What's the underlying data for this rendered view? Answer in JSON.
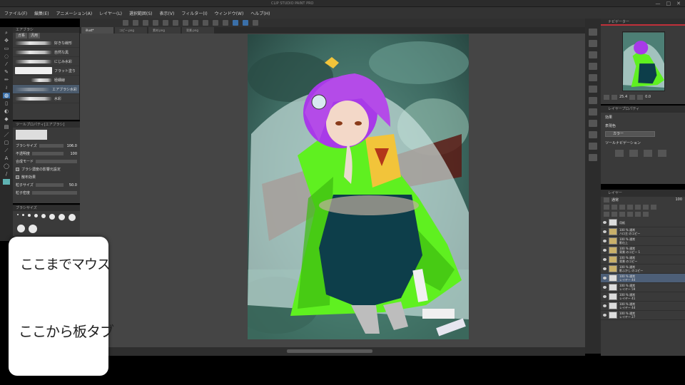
{
  "window": {
    "title": "CLIP STUDIO PAINT PRO",
    "controls": [
      "—",
      "□",
      "✕"
    ]
  },
  "menu": {
    "items": [
      "ファイル(F)",
      "編集(E)",
      "アニメーション(A)",
      "レイヤー(L)",
      "選択範囲(S)",
      "表示(V)",
      "フィルター(I)",
      "ウィンドウ(W)",
      "ヘルプ(H)"
    ]
  },
  "tabs": {
    "documents": [
      "illust*",
      "コピー.png",
      "素材.png",
      "背景.png"
    ]
  },
  "toolbar": {
    "tools": [
      "zoom",
      "move",
      "select",
      "lasso",
      "eyedropper",
      "pen",
      "pencil",
      "brush",
      "airbrush",
      "eraser",
      "fill",
      "gradient",
      "figure",
      "text",
      "balloon",
      "line"
    ]
  },
  "subtool": {
    "title": "エアブラシ",
    "tabs": [
      "ガ系",
      "汎用"
    ],
    "brushes": [
      {
        "name": "好きな線形"
      },
      {
        "name": "自然な黒"
      },
      {
        "name": "にじみ水彩"
      },
      {
        "name": "フラット塗り"
      },
      {
        "name": "極細線"
      },
      {
        "name": "エアブラシ水彩"
      },
      {
        "name": "水彩"
      }
    ]
  },
  "tool_property": {
    "title": "ツールプロパティ[エアブラシ]",
    "rows": [
      {
        "label": "ブラシサイズ",
        "value": "106.0"
      },
      {
        "label": "不透明度",
        "value": "100"
      },
      {
        "label": "合成モード",
        "value": ""
      },
      {
        "label": "ブラシ濃度",
        "value": ""
      },
      {
        "label": "粒子サイズ",
        "value": "50.0"
      },
      {
        "label": "粒子密度",
        "value": ""
      }
    ],
    "checks": [
      "ブラシ濃度の影響元設定",
      "散布効果"
    ]
  },
  "brush_size": {
    "title": "ブラシサイズ",
    "sizes": [
      "2",
      "3",
      "5",
      "7",
      "10",
      "12",
      "15",
      "20",
      "25",
      "30"
    ]
  },
  "navigator": {
    "title": "ナビゲーター",
    "zoom": "25.4",
    "rotation": "0.0"
  },
  "layer_property": {
    "title": "レイヤープロパティ",
    "effect_label": "効果",
    "color_label": "表現色",
    "color_value": "カラー",
    "tone_label": "ツールナビゲーション"
  },
  "layer_panel": {
    "title": "レイヤー",
    "blend_mode": "通常",
    "opacity": "100",
    "layers": [
      {
        "name": "用紙",
        "mode": "",
        "type": "paper"
      },
      {
        "name": "100 % 通常",
        "sub": "ハロ主 のコピー",
        "type": "folder"
      },
      {
        "name": "100 % 通常",
        "sub": "影仕上",
        "type": "folder"
      },
      {
        "name": "100 % 通常",
        "sub": "背景 のコピー 1",
        "type": "folder"
      },
      {
        "name": "100 % 通常",
        "sub": "背景 のコピー",
        "type": "folder"
      },
      {
        "name": "100 % 通常",
        "sub": "影ふかし のコピー",
        "type": "folder"
      },
      {
        "name": "100 % 通常",
        "sub": "レイヤー 44",
        "type": "layer",
        "active": true
      },
      {
        "name": "100 % 通常",
        "sub": "レイヤー 59",
        "type": "layer"
      },
      {
        "name": "100 % 通常",
        "sub": "レイヤー 41",
        "type": "layer"
      },
      {
        "name": "100 % 通常",
        "sub": "レイヤー 44",
        "type": "layer"
      },
      {
        "name": "100 % 通常",
        "sub": "レイヤー 27",
        "type": "layer"
      }
    ]
  },
  "caption": {
    "line1": "ここまでマウス",
    "line2": "ここから板タブ"
  }
}
